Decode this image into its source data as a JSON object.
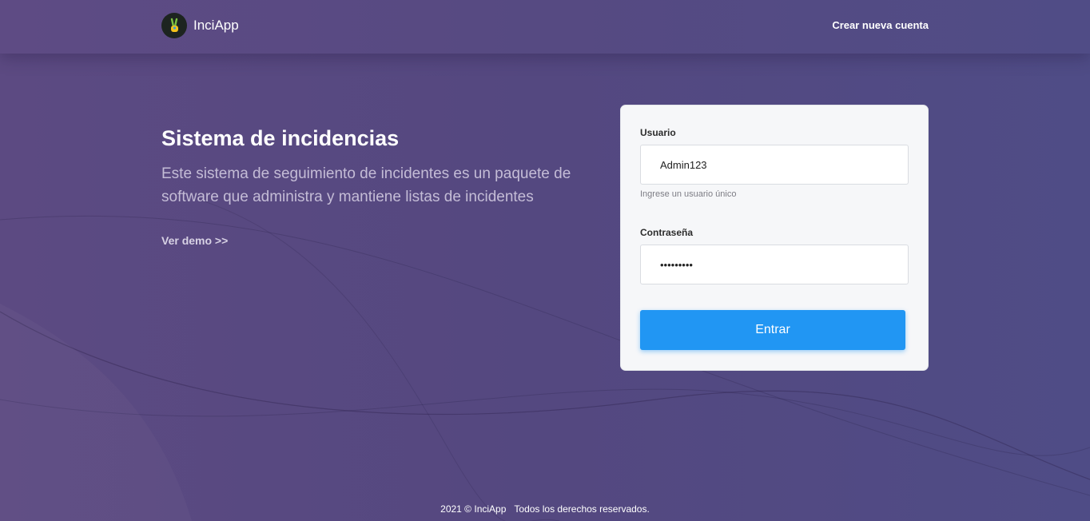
{
  "navbar": {
    "brand_name": "InciApp",
    "logo_icon": "peace-hand-icon",
    "create_account_label": "Crear nueva cuenta"
  },
  "hero": {
    "title": "Sistema de incidencias",
    "description": "Este sistema de seguimiento de incidentes es un paquete de software que administra y mantiene listas de incidentes",
    "demo_link": "Ver demo >>"
  },
  "login": {
    "username_label": "Usuario",
    "username_value": "Admin123",
    "username_help": "Ingrese un usuario único",
    "password_label": "Contraseña",
    "password_value": "secret123",
    "submit_label": "Entrar"
  },
  "footer": {
    "copyright": "2021 © InciApp",
    "rights": "Todos los derechos reservados."
  },
  "colors": {
    "background": "#554882",
    "primary_button": "#2196f3",
    "card_background": "#f6f7f9"
  }
}
